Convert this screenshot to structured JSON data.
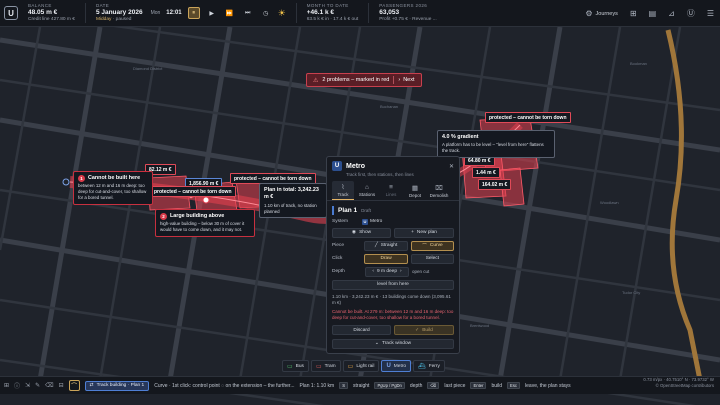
{
  "topbar": {
    "logo": "U",
    "balance_label": "BALANCE",
    "balance_value": "48.05 m €",
    "credit_line": "Credit line 427.80 m €",
    "date_label": "DATE",
    "date_value": "5 January 2026",
    "date_status_a": "Midday",
    "date_status_b": "· paused",
    "speed_label": "Mon",
    "clock": "12:01",
    "month_label": "MONTH TO DATE",
    "month_value": "+46.1 k €",
    "month_in": "63.5 k € in",
    "month_out": "· 17.4 k € out",
    "passengers_label": "PASSENGERS 2026",
    "passengers_value": "63,053",
    "profit": "Profit +0.75 €",
    "revenue": "Revenue ...",
    "journeys": "Journeys"
  },
  "map": {
    "streets": [
      "Diamond District",
      "Bookman",
      "Buchanan",
      "Tudor City",
      "Woodlawn",
      "Brentwood"
    ],
    "problems": {
      "text": "2 problems – marked in red",
      "next": "Next"
    },
    "tags": {
      "cost1": "82.12 m €",
      "cost2": "1,856.90 m €",
      "cost3": "64.80 m €",
      "cost4": "1.44 m €",
      "cost5": "164.02 m €",
      "protected1": "protected – cannot be torn down",
      "protected2": "protected – cannot be torn down",
      "protected3": "protected – cannot be torn down"
    },
    "tip1": {
      "num": "1",
      "title": "Cannot be built here",
      "body": "between 12 m and 16 m deep: too deep for cut-and-cover, too shallow for a bored tunnel."
    },
    "tip2": {
      "num": "2",
      "title": "Large building above",
      "body": "high-value building – below 30 m of cover it would have to come down, and it may not."
    },
    "plan_total": {
      "title": "Plan in total: 3,242.23 m €",
      "body": "1.10 km of track, no station planned"
    },
    "gradient": {
      "title": "4.0 % gradient",
      "body": "A platform has to be level – \"level from here\" flattens the track."
    }
  },
  "panel": {
    "logo": "U",
    "title": "Metro",
    "subtitle": "Track first, then stations, then lines",
    "tabs": [
      {
        "label": "Track",
        "icon": "⌇"
      },
      {
        "label": "Stations",
        "icon": "⌂"
      },
      {
        "label": "Lines",
        "icon": "≡"
      },
      {
        "label": "Depot",
        "icon": "▦"
      },
      {
        "label": "Demolish",
        "icon": "⌧"
      }
    ],
    "plan_title": "Plan 1",
    "plan_status": "Draft",
    "system_label": "System",
    "system_value": "Metro",
    "show_label": "Show",
    "new_plan_label": "New plan",
    "piece_label": "Piece",
    "straight_label": "Straight",
    "curve_label": "Curve",
    "click_label": "Click",
    "draw_label": "Draw",
    "select_label": "Select",
    "depth_label": "Depth",
    "depth_value": "9 m deep",
    "depth_hint": "open cut",
    "level_label": "level from here",
    "stats": "1.10 km · 3,242.23 m € · 13 buildings come down (3,095.61 m €)",
    "error": "Cannot be built. At 279 m: between 12 m and 16 m deep: too deep for cut-and-cover, too shallow for a bored tunnel.",
    "discard_label": "Discard",
    "build_label": "Build",
    "track_window_label": "Track window"
  },
  "modes": [
    {
      "label": "Bus",
      "icon": "▭"
    },
    {
      "label": "Tram",
      "icon": "▭"
    },
    {
      "label": "Light rail",
      "icon": "▭"
    },
    {
      "label": "Metro",
      "icon": "U"
    },
    {
      "label": "Ferry",
      "icon": "⛴"
    }
  ],
  "status": {
    "chip": "Track building · Plan 1",
    "hint": "Curve · 1st click: control point ◌ on the extension – the further...",
    "plan": "Plan 1: 1.10 km",
    "k1": "S",
    "k1t": "straight",
    "k2": "PgUp / PgDn",
    "k2t": "depth",
    "k3": "⌫",
    "k3t": "last piece",
    "k4": "Enter",
    "k4t": "build",
    "k5": "Esc",
    "k5t": "leave, the plan stays",
    "scale": "0.73 m/px",
    "latlon": "40.7510° N · 73.9732° W",
    "credit": "© OpenStreetMap contributors"
  },
  "colors": {
    "problem_red": "#e04a58",
    "accent_gold": "#e3b466",
    "metro_blue": "#4f7fd4"
  }
}
